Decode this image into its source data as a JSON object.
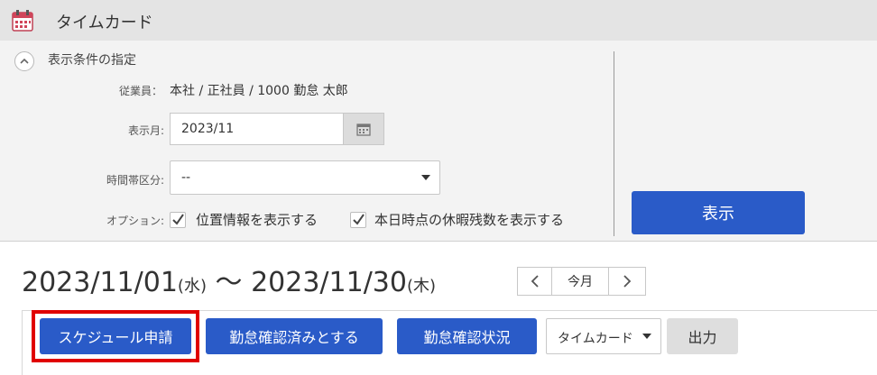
{
  "app": {
    "title": "タイムカード"
  },
  "conditions": {
    "title": "表示条件の指定",
    "employee_label": "従業員：",
    "employee_value": "本社 / 正社員 / 1000 勤怠 太郎",
    "month_label": "表示月:",
    "month_value": "2023/11",
    "zone_label": "時間帯区分:",
    "zone_value": "--",
    "option_label": "オプション:",
    "option1_label": "位置情報を表示する",
    "option1_checked": true,
    "option2_label": "本日時点の休暇残数を表示する",
    "option2_checked": true,
    "show_button": "表示"
  },
  "range": {
    "start": "2023/11/01",
    "start_day": "(水)",
    "sep": "〜",
    "end": "2023/11/30",
    "end_day": "(木)"
  },
  "nav": {
    "today": "今月"
  },
  "toolbar": {
    "schedule_request": "スケジュール申請",
    "confirm_attendance": "勤怠確認済みとする",
    "confirm_status": "勤怠確認状況",
    "format_value": "タイムカード",
    "output": "出力"
  },
  "colors": {
    "primary": "#2a5bc8",
    "highlight": "#e00000",
    "calendar_icon": "#d0455a"
  }
}
